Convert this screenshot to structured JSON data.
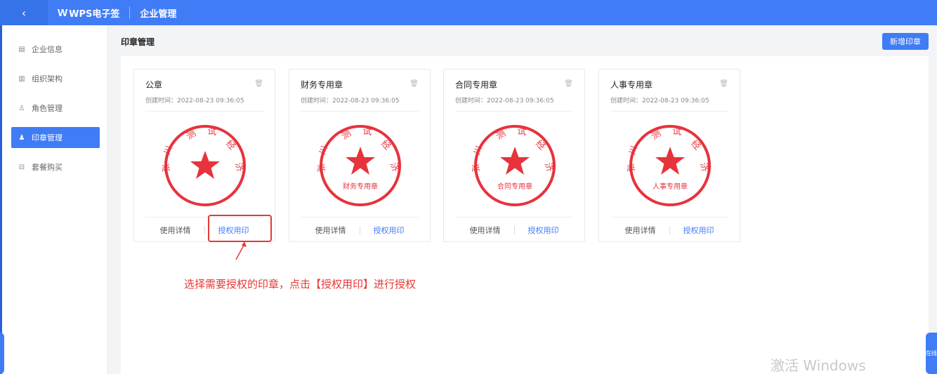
{
  "topbar": {
    "back_icon": "chevron-left-icon",
    "logo_mark": "W",
    "logo_text": "WPS电子签",
    "app_title": "企业管理"
  },
  "sidebar": {
    "items": [
      {
        "label": "企业信息",
        "icon": "building-icon",
        "active": false
      },
      {
        "label": "组织架构",
        "icon": "org-icon",
        "active": false
      },
      {
        "label": "角色管理",
        "icon": "user-icon",
        "active": false
      },
      {
        "label": "印章管理",
        "icon": "seal-icon",
        "active": true
      },
      {
        "label": "套餐购买",
        "icon": "cart-icon",
        "active": false
      }
    ]
  },
  "main": {
    "title": "印章管理",
    "new_button": "新增印章"
  },
  "cards": [
    {
      "title": "公章",
      "time": "创建时间：2022-08-23 09:36:05",
      "seal_top": "测试经济",
      "seal_bottom": "",
      "detail": "使用详情",
      "auth": "授权用印"
    },
    {
      "title": "财务专用章",
      "time": "创建时间：2022-08-23 09:36:05",
      "seal_top": "测试经济",
      "seal_bottom": "财务专用章",
      "detail": "使用详情",
      "auth": "授权用印"
    },
    {
      "title": "合同专用章",
      "time": "创建时间：2022-08-23 09:36:05",
      "seal_top": "测试经济",
      "seal_bottom": "合同专用章",
      "detail": "使用详情",
      "auth": "授权用印"
    },
    {
      "title": "人事专用章",
      "time": "创建时间：2022-08-23 09:36:05",
      "seal_top": "测试经济",
      "seal_bottom": "人事专用章",
      "detail": "使用详情",
      "auth": "授权用印"
    }
  ],
  "annotation": "选择需要授权的印章，点击【授权用印】进行授权",
  "watermark": "激活 Windows",
  "float_right_text": "在线",
  "colors": {
    "primary": "#3f7cf5",
    "seal": "#e8323c",
    "annotation": "#e53935"
  }
}
